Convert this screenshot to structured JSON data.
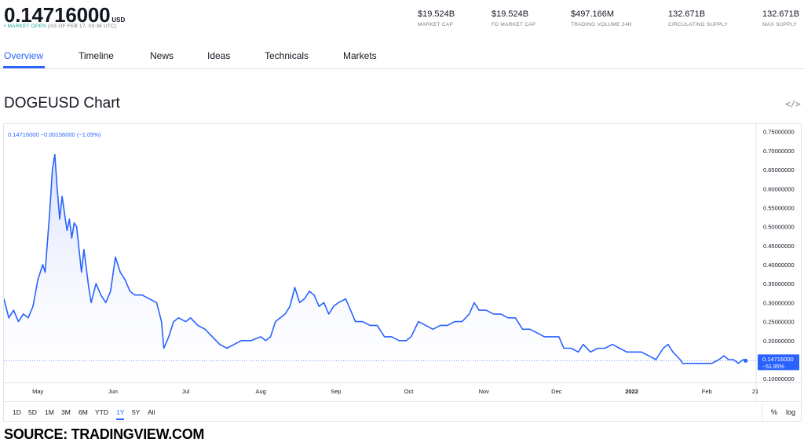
{
  "header": {
    "price": "0.14716000",
    "currency": "USD",
    "status_dot": "•",
    "status_text": "MARKET OPEN",
    "status_time": "(AS OF FEB 17, 09:36 UTC)",
    "stats": [
      {
        "value": "$19.524B",
        "label": "MARKET CAP"
      },
      {
        "value": "$19.524B",
        "label": "FD MARKET CAP"
      },
      {
        "value": "$497.166M",
        "label": "TRADING VOLUME 24H"
      },
      {
        "value": "132.671B",
        "label": "CIRCULATING SUPPLY"
      },
      {
        "value": "132.671B",
        "label": "MAX SUPPLY"
      }
    ]
  },
  "tabs": [
    {
      "label": "Overview",
      "active": true
    },
    {
      "label": "Timeline",
      "active": false
    },
    {
      "label": "News",
      "active": false
    },
    {
      "label": "Ideas",
      "active": false
    },
    {
      "label": "Technicals",
      "active": false
    },
    {
      "label": "Markets",
      "active": false
    }
  ],
  "chart_title": "DOGEUSD Chart",
  "embed_icon": "</>",
  "legend": {
    "price": "0.14716000",
    "change": "−0.00156000",
    "change_pct": "(−1.05%)"
  },
  "timeframes": {
    "items": [
      "1D",
      "5D",
      "1M",
      "3M",
      "6M",
      "YTD",
      "1Y",
      "5Y",
      "All"
    ],
    "active": "1Y"
  },
  "scale_buttons": [
    "%",
    "log"
  ],
  "source": "SOURCE: TRADINGVIEW.COM",
  "colors": {
    "line": "#2962ff",
    "fill_top": "#d4dcfc",
    "label_bg": "#2962ff",
    "axis_text": "#131722"
  },
  "chart_data": {
    "type": "area",
    "title": "DOGEUSD Chart",
    "xlabel": "",
    "ylabel": "",
    "ylim": [
      0.09,
      0.77
    ],
    "y_ticks": [
      0.1,
      0.15,
      0.2,
      0.25,
      0.3,
      0.35,
      0.4,
      0.45,
      0.5,
      0.55,
      0.6,
      0.65,
      0.7,
      0.75
    ],
    "y_tick_labels": [
      "0.10000000",
      "0.15000000",
      "0.20000000",
      "0.25000000",
      "0.30000000",
      "0.35000000",
      "0.40000000",
      "0.45000000",
      "0.50000000",
      "0.55000000",
      "0.60000000",
      "0.65000000",
      "0.70000000",
      "0.75000000"
    ],
    "x_range": [
      "2021-04-17",
      "2022-02-21"
    ],
    "x_ticks": [
      {
        "date": "2021-05-01",
        "label": "May"
      },
      {
        "date": "2021-06-01",
        "label": "Jun"
      },
      {
        "date": "2021-07-01",
        "label": "Jul"
      },
      {
        "date": "2021-08-01",
        "label": "Aug"
      },
      {
        "date": "2021-09-01",
        "label": "Sep"
      },
      {
        "date": "2021-10-01",
        "label": "Oct"
      },
      {
        "date": "2021-11-01",
        "label": "Nov"
      },
      {
        "date": "2021-12-01",
        "label": "Dec"
      },
      {
        "date": "2022-01-01",
        "label": "2022"
      },
      {
        "date": "2022-02-01",
        "label": "Feb"
      },
      {
        "date": "2022-02-21",
        "label": "21"
      }
    ],
    "last_value": "0.14716000",
    "last_change_pct": "−51.95%",
    "series": [
      {
        "points": [
          [
            "2021-04-17",
            0.31
          ],
          [
            "2021-04-19",
            0.26
          ],
          [
            "2021-04-21",
            0.28
          ],
          [
            "2021-04-23",
            0.25
          ],
          [
            "2021-04-25",
            0.27
          ],
          [
            "2021-04-27",
            0.26
          ],
          [
            "2021-04-29",
            0.29
          ],
          [
            "2021-05-01",
            0.36
          ],
          [
            "2021-05-03",
            0.4
          ],
          [
            "2021-05-04",
            0.38
          ],
          [
            "2021-05-06",
            0.55
          ],
          [
            "2021-05-07",
            0.65
          ],
          [
            "2021-05-08",
            0.69
          ],
          [
            "2021-05-09",
            0.6
          ],
          [
            "2021-05-10",
            0.52
          ],
          [
            "2021-05-11",
            0.58
          ],
          [
            "2021-05-13",
            0.49
          ],
          [
            "2021-05-14",
            0.52
          ],
          [
            "2021-05-15",
            0.47
          ],
          [
            "2021-05-16",
            0.51
          ],
          [
            "2021-05-17",
            0.5
          ],
          [
            "2021-05-19",
            0.38
          ],
          [
            "2021-05-20",
            0.44
          ],
          [
            "2021-05-22",
            0.34
          ],
          [
            "2021-05-23",
            0.3
          ],
          [
            "2021-05-25",
            0.35
          ],
          [
            "2021-05-27",
            0.32
          ],
          [
            "2021-05-29",
            0.3
          ],
          [
            "2021-05-31",
            0.33
          ],
          [
            "2021-06-02",
            0.42
          ],
          [
            "2021-06-04",
            0.38
          ],
          [
            "2021-06-06",
            0.36
          ],
          [
            "2021-06-08",
            0.33
          ],
          [
            "2021-06-10",
            0.32
          ],
          [
            "2021-06-13",
            0.32
          ],
          [
            "2021-06-16",
            0.31
          ],
          [
            "2021-06-19",
            0.3
          ],
          [
            "2021-06-21",
            0.25
          ],
          [
            "2021-06-22",
            0.18
          ],
          [
            "2021-06-24",
            0.21
          ],
          [
            "2021-06-26",
            0.25
          ],
          [
            "2021-06-28",
            0.26
          ],
          [
            "2021-07-01",
            0.25
          ],
          [
            "2021-07-03",
            0.26
          ],
          [
            "2021-07-06",
            0.24
          ],
          [
            "2021-07-09",
            0.23
          ],
          [
            "2021-07-12",
            0.21
          ],
          [
            "2021-07-15",
            0.19
          ],
          [
            "2021-07-18",
            0.18
          ],
          [
            "2021-07-21",
            0.19
          ],
          [
            "2021-07-24",
            0.2
          ],
          [
            "2021-07-28",
            0.2
          ],
          [
            "2021-08-01",
            0.21
          ],
          [
            "2021-08-03",
            0.2
          ],
          [
            "2021-08-05",
            0.21
          ],
          [
            "2021-08-07",
            0.25
          ],
          [
            "2021-08-09",
            0.26
          ],
          [
            "2021-08-11",
            0.27
          ],
          [
            "2021-08-13",
            0.29
          ],
          [
            "2021-08-15",
            0.34
          ],
          [
            "2021-08-17",
            0.3
          ],
          [
            "2021-08-19",
            0.31
          ],
          [
            "2021-08-21",
            0.33
          ],
          [
            "2021-08-23",
            0.32
          ],
          [
            "2021-08-25",
            0.29
          ],
          [
            "2021-08-27",
            0.3
          ],
          [
            "2021-08-29",
            0.27
          ],
          [
            "2021-08-31",
            0.29
          ],
          [
            "2021-09-02",
            0.3
          ],
          [
            "2021-09-05",
            0.31
          ],
          [
            "2021-09-07",
            0.28
          ],
          [
            "2021-09-09",
            0.25
          ],
          [
            "2021-09-12",
            0.25
          ],
          [
            "2021-09-15",
            0.24
          ],
          [
            "2021-09-18",
            0.24
          ],
          [
            "2021-09-21",
            0.21
          ],
          [
            "2021-09-24",
            0.21
          ],
          [
            "2021-09-27",
            0.2
          ],
          [
            "2021-09-30",
            0.2
          ],
          [
            "2021-10-02",
            0.21
          ],
          [
            "2021-10-05",
            0.25
          ],
          [
            "2021-10-08",
            0.24
          ],
          [
            "2021-10-11",
            0.23
          ],
          [
            "2021-10-14",
            0.24
          ],
          [
            "2021-10-17",
            0.24
          ],
          [
            "2021-10-20",
            0.25
          ],
          [
            "2021-10-23",
            0.25
          ],
          [
            "2021-10-26",
            0.27
          ],
          [
            "2021-10-28",
            0.3
          ],
          [
            "2021-10-30",
            0.28
          ],
          [
            "2021-11-02",
            0.28
          ],
          [
            "2021-11-05",
            0.27
          ],
          [
            "2021-11-08",
            0.27
          ],
          [
            "2021-11-11",
            0.26
          ],
          [
            "2021-11-14",
            0.26
          ],
          [
            "2021-11-17",
            0.23
          ],
          [
            "2021-11-20",
            0.23
          ],
          [
            "2021-11-23",
            0.22
          ],
          [
            "2021-11-26",
            0.21
          ],
          [
            "2021-11-29",
            0.21
          ],
          [
            "2021-12-02",
            0.21
          ],
          [
            "2021-12-04",
            0.18
          ],
          [
            "2021-12-07",
            0.18
          ],
          [
            "2021-12-10",
            0.17
          ],
          [
            "2021-12-12",
            0.19
          ],
          [
            "2021-12-15",
            0.17
          ],
          [
            "2021-12-18",
            0.18
          ],
          [
            "2021-12-21",
            0.18
          ],
          [
            "2021-12-24",
            0.19
          ],
          [
            "2021-12-27",
            0.18
          ],
          [
            "2021-12-30",
            0.17
          ],
          [
            "2022-01-02",
            0.17
          ],
          [
            "2022-01-05",
            0.17
          ],
          [
            "2022-01-08",
            0.16
          ],
          [
            "2022-01-11",
            0.15
          ],
          [
            "2022-01-14",
            0.18
          ],
          [
            "2022-01-16",
            0.19
          ],
          [
            "2022-01-18",
            0.17
          ],
          [
            "2022-01-21",
            0.15
          ],
          [
            "2022-01-22",
            0.14
          ],
          [
            "2022-01-25",
            0.14
          ],
          [
            "2022-01-28",
            0.14
          ],
          [
            "2022-01-31",
            0.14
          ],
          [
            "2022-02-03",
            0.14
          ],
          [
            "2022-02-06",
            0.15
          ],
          [
            "2022-02-08",
            0.16
          ],
          [
            "2022-02-10",
            0.15
          ],
          [
            "2022-02-12",
            0.15
          ],
          [
            "2022-02-14",
            0.14
          ],
          [
            "2022-02-16",
            0.15
          ],
          [
            "2022-02-17",
            0.147
          ]
        ]
      }
    ]
  }
}
